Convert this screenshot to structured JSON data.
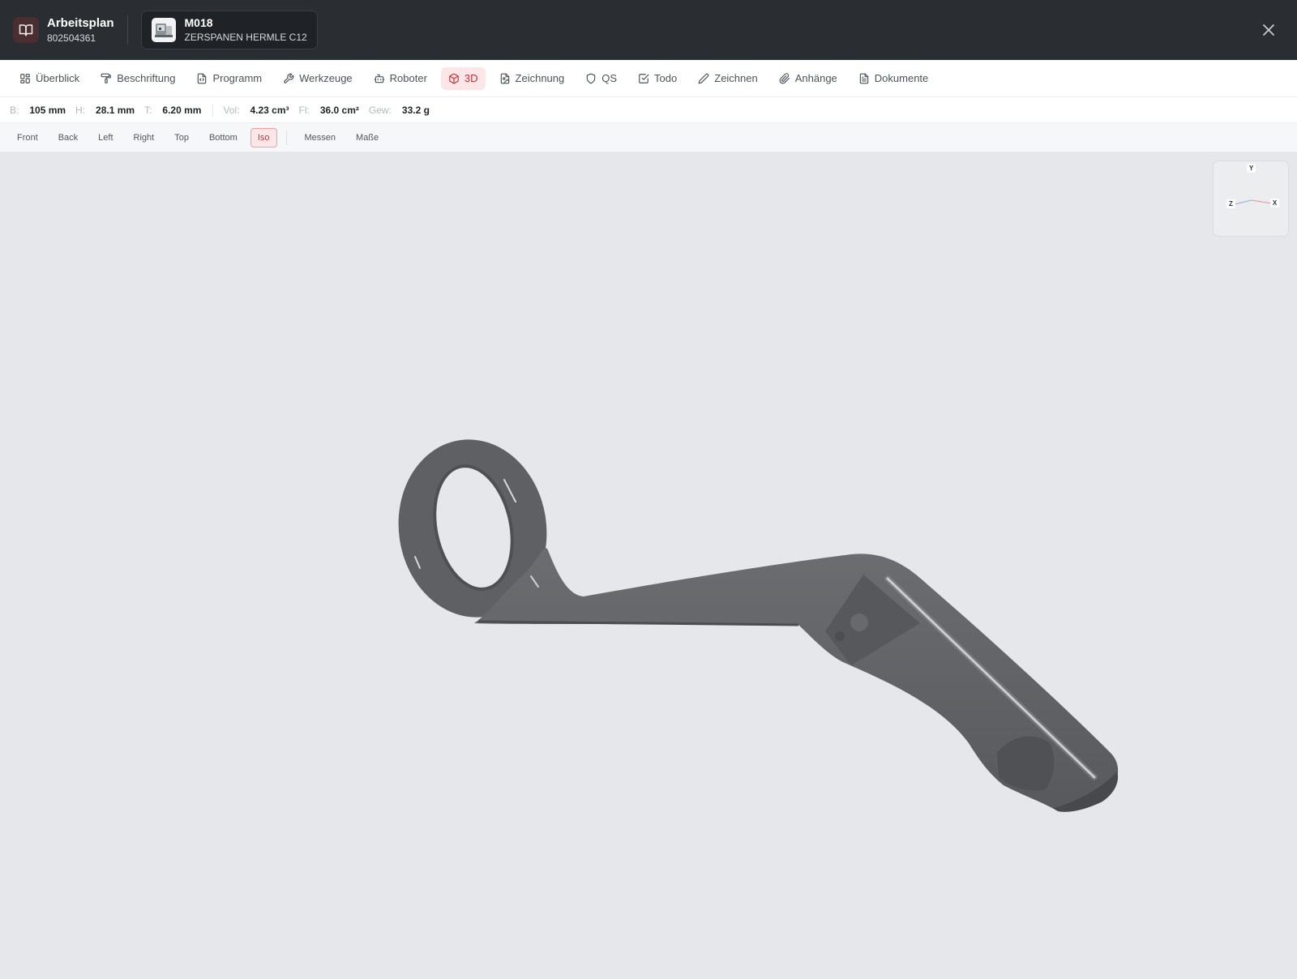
{
  "header": {
    "app_title": "Arbeitsplan",
    "app_subtitle": "802504361",
    "machine_title": "M018",
    "machine_subtitle": "ZERSPANEN HERMLE C12",
    "colors": {
      "bar": "#2a2e33",
      "accent": "#c23338",
      "accent_bg": "#fde6e7"
    }
  },
  "tabs": [
    {
      "label": "Überblick",
      "icon": "grid-icon"
    },
    {
      "label": "Beschriftung",
      "icon": "paint-roller-icon"
    },
    {
      "label": "Programm",
      "icon": "code-file-icon"
    },
    {
      "label": "Werkzeuge",
      "icon": "wrench-icon"
    },
    {
      "label": "Roboter",
      "icon": "robot-icon"
    },
    {
      "label": "3D",
      "icon": "cube-icon",
      "active": true
    },
    {
      "label": "Zeichnung",
      "icon": "image-file-icon"
    },
    {
      "label": "QS",
      "icon": "shield-icon"
    },
    {
      "label": "Todo",
      "icon": "checkbox-icon"
    },
    {
      "label": "Zeichnen",
      "icon": "pencil-icon"
    },
    {
      "label": "Anhänge",
      "icon": "paperclip-icon"
    },
    {
      "label": "Dokumente",
      "icon": "document-icon"
    }
  ],
  "dimensions": {
    "width_label": "B:",
    "width_value": "105 mm",
    "height_label": "H:",
    "height_value": "28.1 mm",
    "depth_label": "T:",
    "depth_value": "6.20 mm",
    "volume_label": "Vol:",
    "volume_value": "4.23 cm³",
    "area_label": "Fl:",
    "area_value": "36.0 cm²",
    "weight_label": "Gew:",
    "weight_value": "33.2 g"
  },
  "view_buttons": {
    "front": "Front",
    "back": "Back",
    "left": "Left",
    "right": "Right",
    "top": "Top",
    "bottom": "Bottom",
    "iso": "Iso",
    "measure": "Messen",
    "dims": "Maße",
    "active": "iso"
  },
  "axis_widget": {
    "y": "Y",
    "z": "Z",
    "x": "X"
  }
}
